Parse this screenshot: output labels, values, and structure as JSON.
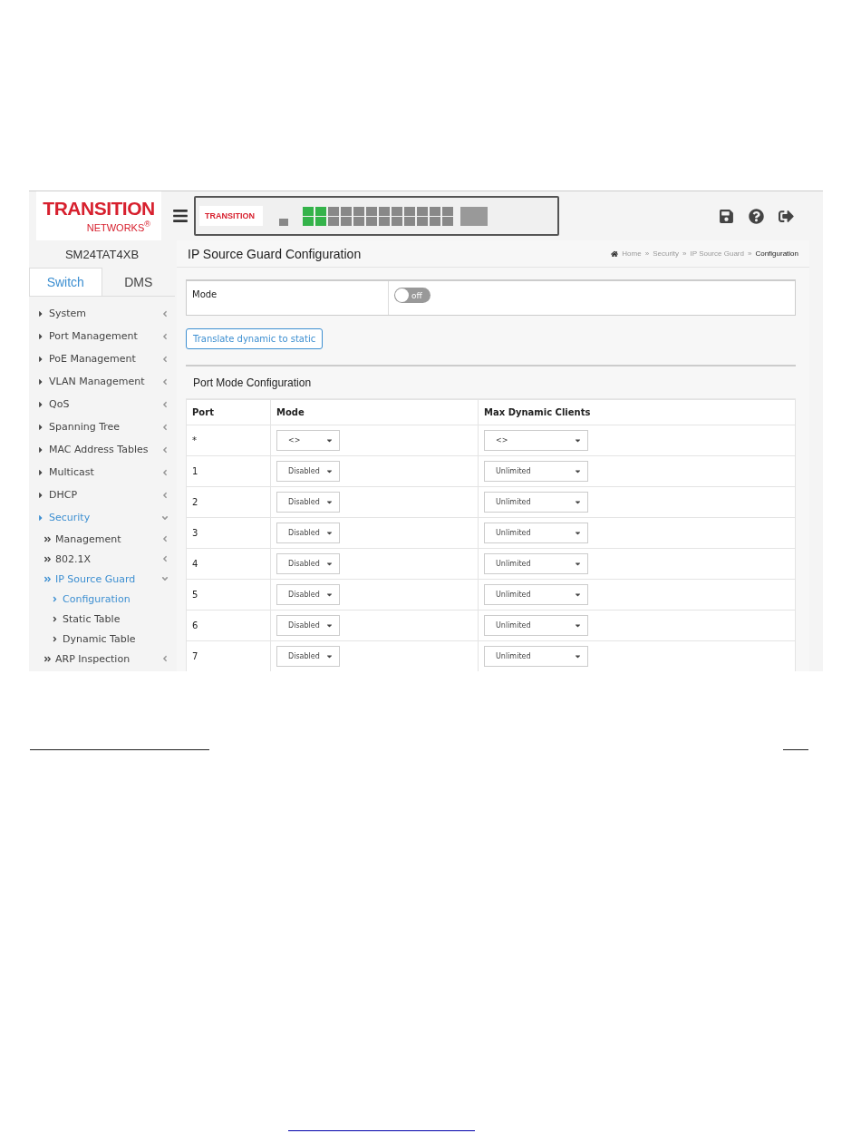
{
  "logo": {
    "name": "TRANSITION",
    "sub": "NETWORKS",
    "mark": "®"
  },
  "device": {
    "model": "SM24TAT4XB"
  },
  "panel": {
    "logo_name": "TRANSITION",
    "ports": [
      {
        "up": true
      },
      {
        "up": true
      },
      {
        "up": true
      },
      {
        "up": true
      },
      {
        "up": false
      },
      {
        "up": false
      },
      {
        "up": false
      },
      {
        "up": false
      },
      {
        "up": false
      },
      {
        "up": false
      },
      {
        "up": false
      },
      {
        "up": false
      },
      {
        "up": false
      },
      {
        "up": false
      },
      {
        "up": false
      },
      {
        "up": false
      },
      {
        "up": false
      },
      {
        "up": false
      },
      {
        "up": false
      },
      {
        "up": false
      },
      {
        "up": false
      },
      {
        "up": false
      },
      {
        "up": false
      },
      {
        "up": false
      }
    ]
  },
  "tabs": [
    {
      "label": "Switch",
      "selected": true
    },
    {
      "label": "DMS",
      "selected": false
    }
  ],
  "sidebar": {
    "items": [
      {
        "label": "System",
        "expanded": false,
        "selected": false
      },
      {
        "label": "Port Management",
        "expanded": false,
        "selected": false
      },
      {
        "label": "PoE Management",
        "expanded": false,
        "selected": false
      },
      {
        "label": "VLAN Management",
        "expanded": false,
        "selected": false
      },
      {
        "label": "QoS",
        "expanded": false,
        "selected": false
      },
      {
        "label": "Spanning Tree",
        "expanded": false,
        "selected": false
      },
      {
        "label": "MAC Address Tables",
        "expanded": false,
        "selected": false
      },
      {
        "label": "Multicast",
        "expanded": false,
        "selected": false
      },
      {
        "label": "DHCP",
        "expanded": false,
        "selected": false
      },
      {
        "label": "Security",
        "expanded": true,
        "selected": true,
        "children": [
          {
            "label": "Management",
            "expanded": false,
            "selected": false
          },
          {
            "label": "802.1X",
            "expanded": false,
            "selected": false
          },
          {
            "label": "IP Source Guard",
            "expanded": true,
            "selected": true,
            "children": [
              {
                "label": "Configuration",
                "selected": true
              },
              {
                "label": "Static Table",
                "selected": false
              },
              {
                "label": "Dynamic Table",
                "selected": false
              }
            ]
          },
          {
            "label": "ARP Inspection",
            "expanded": false,
            "selected": false
          }
        ]
      }
    ]
  },
  "page": {
    "title": "IP Source Guard Configuration"
  },
  "breadcrumb": {
    "separator": "»",
    "items": [
      "Home",
      "Security",
      "IP Source Guard",
      "Configuration"
    ]
  },
  "mode": {
    "label": "Mode",
    "on": false,
    "text": "off"
  },
  "translate_button": "Translate dynamic to static",
  "table": {
    "title": "Port Mode Configuration",
    "columns": [
      "Port",
      "Mode",
      "Max Dynamic Clients"
    ],
    "rows": [
      {
        "port": "*",
        "mode": "<>",
        "max_clients": "<>"
      },
      {
        "port": "1",
        "mode": "Disabled",
        "max_clients": "Unlimited"
      },
      {
        "port": "2",
        "mode": "Disabled",
        "max_clients": "Unlimited"
      },
      {
        "port": "3",
        "mode": "Disabled",
        "max_clients": "Unlimited"
      },
      {
        "port": "4",
        "mode": "Disabled",
        "max_clients": "Unlimited"
      },
      {
        "port": "5",
        "mode": "Disabled",
        "max_clients": "Unlimited"
      },
      {
        "port": "6",
        "mode": "Disabled",
        "max_clients": "Unlimited"
      },
      {
        "port": "7",
        "mode": "Disabled",
        "max_clients": "Unlimited"
      }
    ]
  }
}
